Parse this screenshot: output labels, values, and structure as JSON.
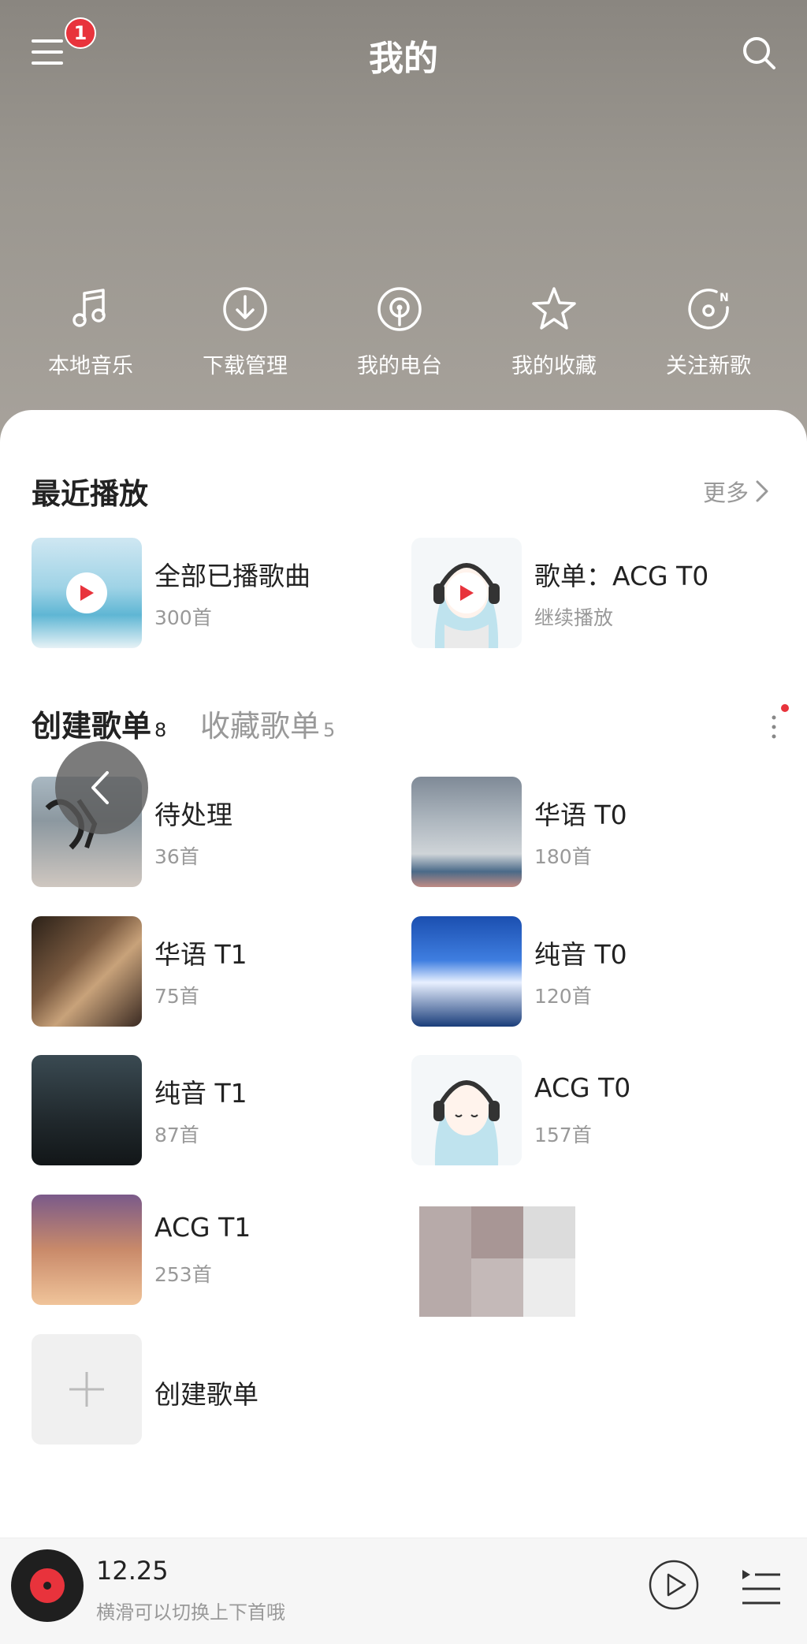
{
  "header": {
    "title": "我的",
    "notification_count": "1"
  },
  "quick_actions": [
    {
      "label": "本地音乐",
      "icon": "music-note-icon"
    },
    {
      "label": "下载管理",
      "icon": "download-icon"
    },
    {
      "label": "我的电台",
      "icon": "radio-icon"
    },
    {
      "label": "我的收藏",
      "icon": "star-icon"
    },
    {
      "label": "关注新歌",
      "icon": "new-songs-icon"
    }
  ],
  "recent": {
    "title": "最近播放",
    "more": "更多",
    "items": [
      {
        "title": "全部已播歌曲",
        "sub": "300首"
      },
      {
        "title": "歌单：ACG T0",
        "sub": "继续播放"
      }
    ]
  },
  "tabs": {
    "created": {
      "label": "创建歌单",
      "count": "8"
    },
    "collected": {
      "label": "收藏歌单",
      "count": "5"
    }
  },
  "playlists": [
    {
      "title": "待处理",
      "sub": "36首"
    },
    {
      "title": "华语 T0",
      "sub": "180首"
    },
    {
      "title": "华语 T1",
      "sub": "75首"
    },
    {
      "title": "纯音 T0",
      "sub": "120首"
    },
    {
      "title": "纯音 T1",
      "sub": "87首"
    },
    {
      "title": "ACG T0",
      "sub": "157首"
    },
    {
      "title": "ACG T1",
      "sub": "253首"
    }
  ],
  "create_playlist": {
    "label": "创建歌单"
  },
  "player": {
    "title": "12.25",
    "subtitle": "横滑可以切换上下首哦"
  },
  "colors": {
    "accent": "#e8333c",
    "header_bg": "#9a968f",
    "muted_text": "#999999"
  }
}
